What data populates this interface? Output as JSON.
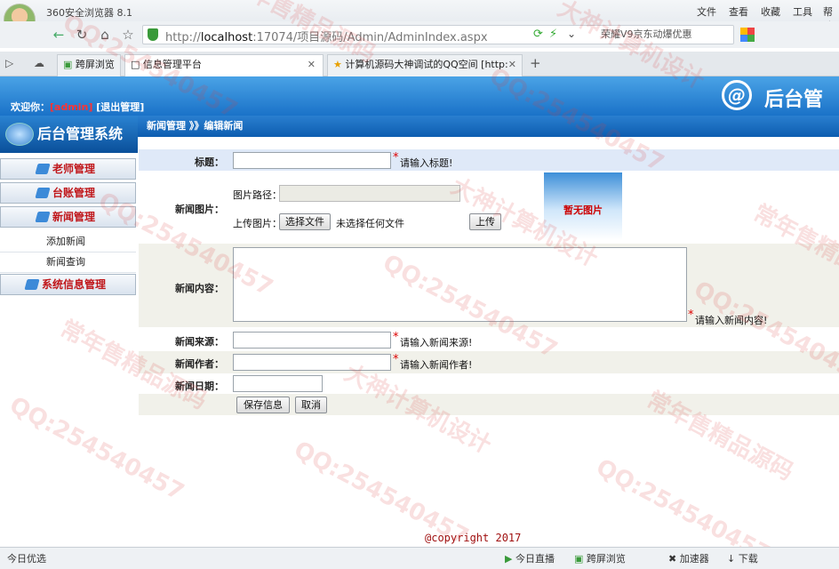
{
  "browser": {
    "name": "360安全浏览器 8.1",
    "menu": [
      "文件",
      "查看",
      "收藏",
      "工具",
      "帮助"
    ],
    "url_prefix": "http://",
    "url_host": "localhost",
    "url_rest": ":17074/项目源码/Admin/AdminIndex.aspx",
    "search_text": "荣耀V9京东动爆优惠",
    "tabs": [
      {
        "label": "跨屏浏览"
      },
      {
        "label": "信息管理平台"
      },
      {
        "label": "计算机源码大神调试的QQ空间 [http:"
      }
    ],
    "new_tab": "+"
  },
  "header": {
    "welcome": "欢迎你：",
    "user": "[admin]",
    "logout": "[退出管理]",
    "banner_title": "后台管"
  },
  "sidebar": {
    "title": "后台管理系统",
    "items": [
      {
        "label": "老师管理"
      },
      {
        "label": "台账管理"
      },
      {
        "label": "新闻管理"
      }
    ],
    "subitems": [
      {
        "label": "添加新闻"
      },
      {
        "label": "新闻查询"
      }
    ],
    "last_item": "系统信息管理"
  },
  "breadcrumb": "新闻管理 》》编辑新闻",
  "form": {
    "title_label": "标题：",
    "title_hint": "请输入标题!",
    "image_label": "新闻图片：",
    "image_path_label": "图片路径：",
    "upload_label": "上传图片：",
    "choose_file_btn": "选择文件",
    "no_file_text": "未选择任何文件",
    "upload_btn": "上传",
    "no_image_text": "暂无图片",
    "content_label": "新闻内容：",
    "content_hint": "请输入新闻内容!",
    "source_label": "新闻来源：",
    "source_hint": "请输入新闻来源!",
    "author_label": "新闻作者：",
    "author_hint": "请输入新闻作者!",
    "date_label": "新闻日期：",
    "save_btn": "保存信息",
    "cancel_btn": "取消",
    "required_mark": "*"
  },
  "footer": "@copyright 2017",
  "statusbar": {
    "left": "今日优选",
    "items": [
      "今日直播",
      "跨屏浏览",
      "加速器",
      "下载"
    ]
  },
  "watermarks": [
    "QQ:254540457",
    "大神计算机设计",
    "常年售精品源码"
  ]
}
